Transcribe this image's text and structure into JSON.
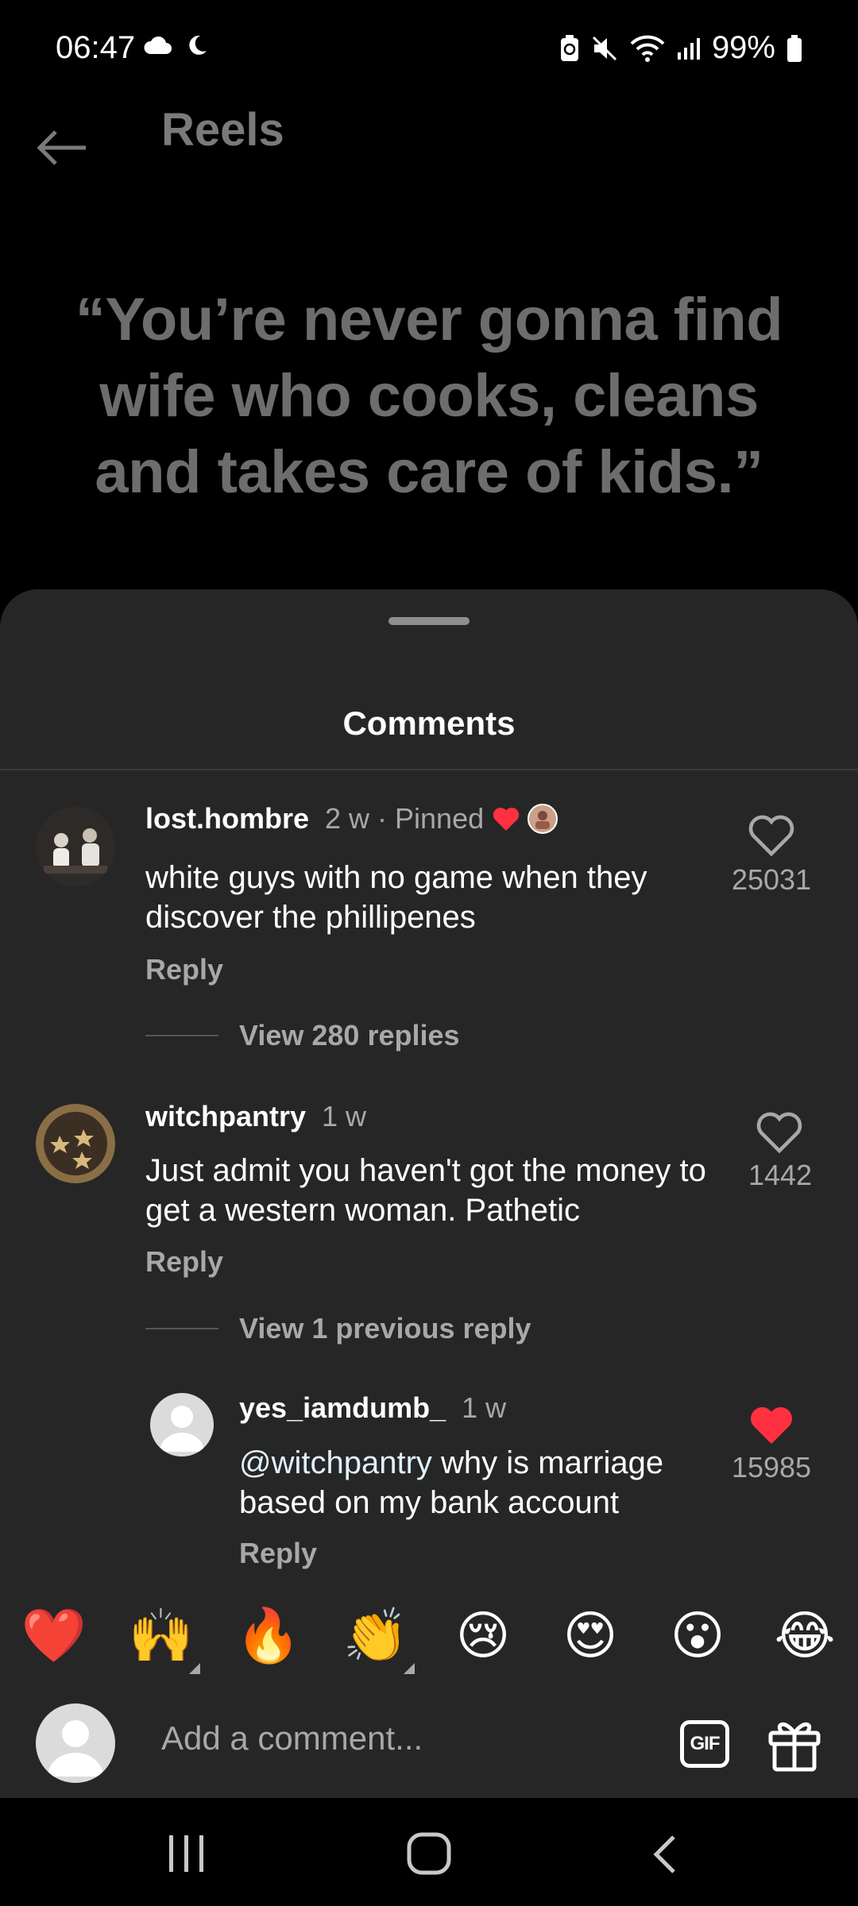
{
  "status_bar": {
    "time": "06:47",
    "battery": "99%"
  },
  "header": {
    "title": "Reels"
  },
  "reel": {
    "quote_lines": [
      "“You’re never gonna find",
      "wife who cooks, cleans",
      "and takes care of kids.”"
    ]
  },
  "sheet": {
    "title": "Comments"
  },
  "comments": [
    {
      "user": "lost.hombre",
      "meta": "2 w · Pinned",
      "text": "white guys with no game when they discover the phillipenes",
      "reply_label": "Reply",
      "likes": "25031",
      "view_replies": "View 280 replies"
    },
    {
      "user": "witchpantry",
      "meta": "1 w",
      "text": "Just admit you haven't got the money to get a western woman. Pathetic",
      "reply_label": "Reply",
      "likes": "1442",
      "view_replies": "View 1 previous reply"
    },
    {
      "user": "yes_iamdumb_",
      "meta": "1 w",
      "mention": "@witchpantry",
      "text": " why is marriage based on my bank account",
      "reply_label": "Reply",
      "likes": "15985",
      "liked": true
    }
  ],
  "emoji_bar": [
    "❤️",
    "🙌",
    "🔥",
    "👏",
    "😢",
    "😍",
    "😮",
    "😂"
  ],
  "composer": {
    "placeholder": "Add a comment...",
    "gif_label": "GIF"
  },
  "colors": {
    "like_red": "#ff3040",
    "sheet_bg": "#262626"
  }
}
